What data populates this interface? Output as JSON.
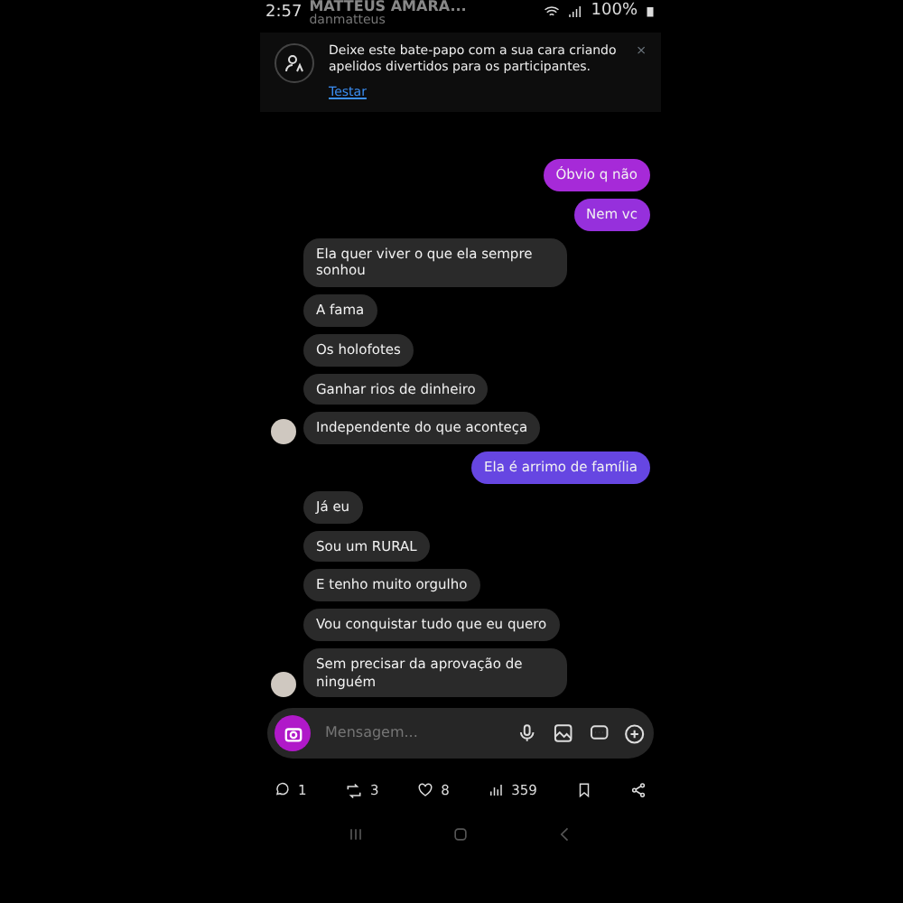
{
  "status_bar": {
    "time": "2:57",
    "battery": "100%"
  },
  "header": {
    "title": "MATTEUS AMARA...",
    "username": "danmatteus"
  },
  "banner": {
    "text": "Deixe este bate-papo com a sua cara criando apelidos divertidos para os participantes.",
    "action": "Testar",
    "close": "×"
  },
  "messages": [
    {
      "kind": "out",
      "text": "Óbvio q não",
      "color": "#a62ad8"
    },
    {
      "kind": "out",
      "text": "Nem vc",
      "color": "#9630dc"
    },
    {
      "kind": "in",
      "text": "Ela quer viver o que ela sempre sonhou",
      "avatar": false
    },
    {
      "kind": "in",
      "text": "A fama",
      "avatar": false
    },
    {
      "kind": "in",
      "text": "Os holofotes",
      "avatar": false
    },
    {
      "kind": "in",
      "text": "Ganhar rios de dinheiro",
      "avatar": false
    },
    {
      "kind": "in",
      "text": "Independente do que aconteça",
      "avatar": true
    },
    {
      "kind": "out",
      "text": "Ela é arrimo de família",
      "color": "#6646e2"
    },
    {
      "kind": "in",
      "text": "Já eu",
      "avatar": false
    },
    {
      "kind": "in",
      "text": "Sou um RURAL",
      "avatar": false
    },
    {
      "kind": "in",
      "text": "E tenho muito orgulho",
      "avatar": false
    },
    {
      "kind": "in",
      "text": "Vou conquistar tudo que eu quero",
      "avatar": false
    },
    {
      "kind": "in",
      "text": "Sem precisar da aprovação de ninguém",
      "avatar": true
    }
  ],
  "composer": {
    "placeholder": "Mensagem..."
  },
  "stats": {
    "replies": "1",
    "reposts": "3",
    "likes": "8",
    "views": "359"
  }
}
